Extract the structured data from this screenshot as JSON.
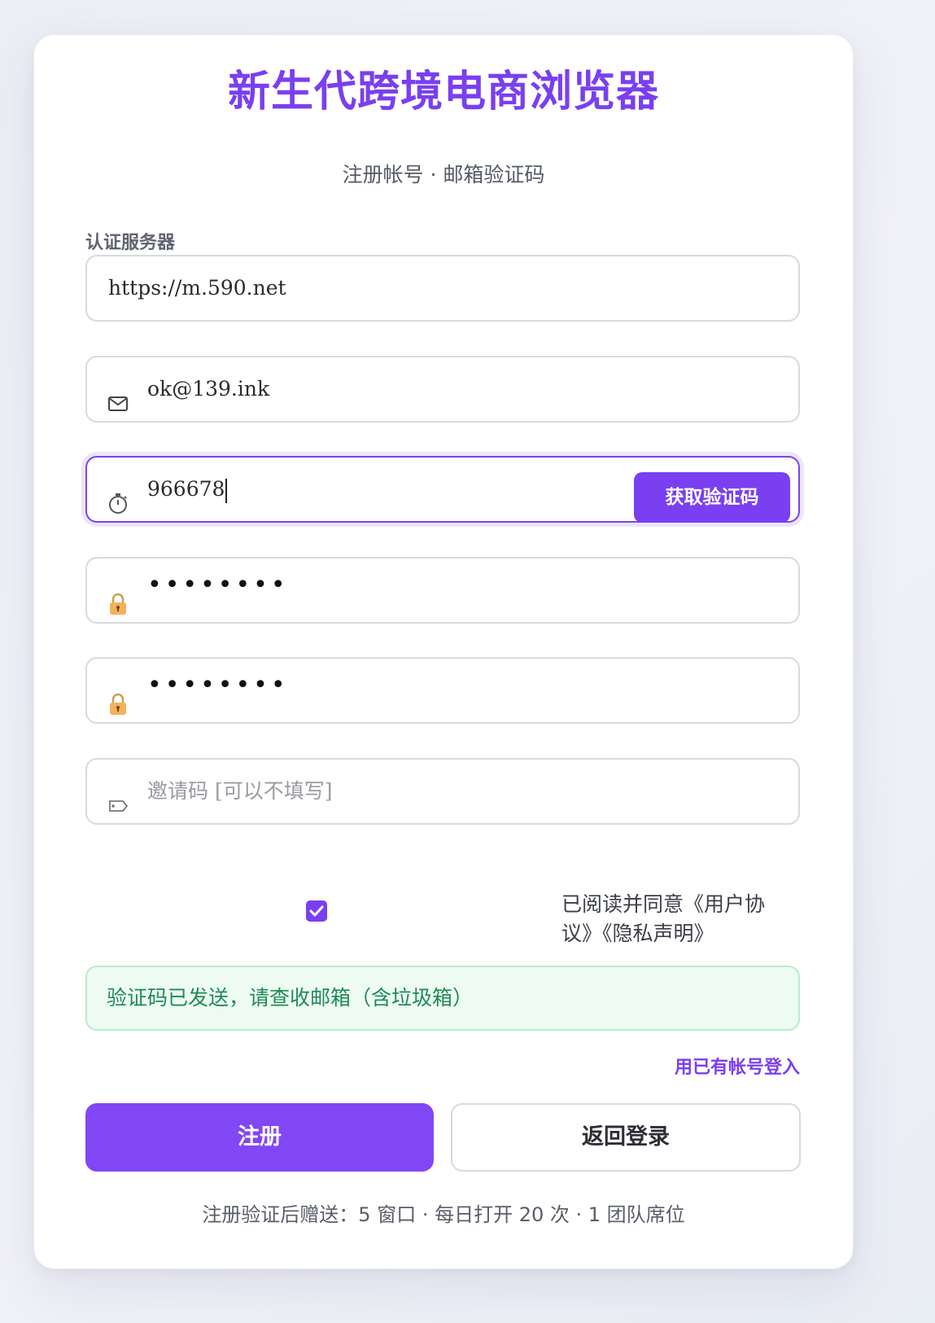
{
  "header": {
    "title": "新生代跨境电商浏览器",
    "subtitle": "注册帐号 · 邮箱验证码"
  },
  "form": {
    "server_label": "认证服务器",
    "server_value": "https://m.590.net",
    "email_value": "ok@139.ink",
    "code_value": "966678",
    "get_code_label": "获取验证码",
    "password_mask": "••••••••",
    "confirm_password_mask": "••••••••",
    "invite_placeholder": "邀请码 [可以不填写]",
    "agree_checked": true,
    "agree_text": "已阅读并同意《用户协议》《隐私声明》"
  },
  "notice": {
    "text": "验证码已发送，请查收邮箱（含垃圾箱）",
    "color": "#1f8a52"
  },
  "links": {
    "login_existing": "用已有帐号登入"
  },
  "buttons": {
    "register": "注册",
    "back_to_login": "返回登录"
  },
  "footer": {
    "text": "注册验证后赠送：5 窗口 · 每日打开 20 次 · 1 团队席位"
  },
  "icons": {
    "email": "envelope-icon",
    "code": "stopwatch-icon",
    "password": "lock-icon",
    "confirm_password": "lock-icon",
    "invite": "tag-icon"
  },
  "colors": {
    "accent": "#7a3ff0",
    "primary_button": "#8247f5"
  }
}
